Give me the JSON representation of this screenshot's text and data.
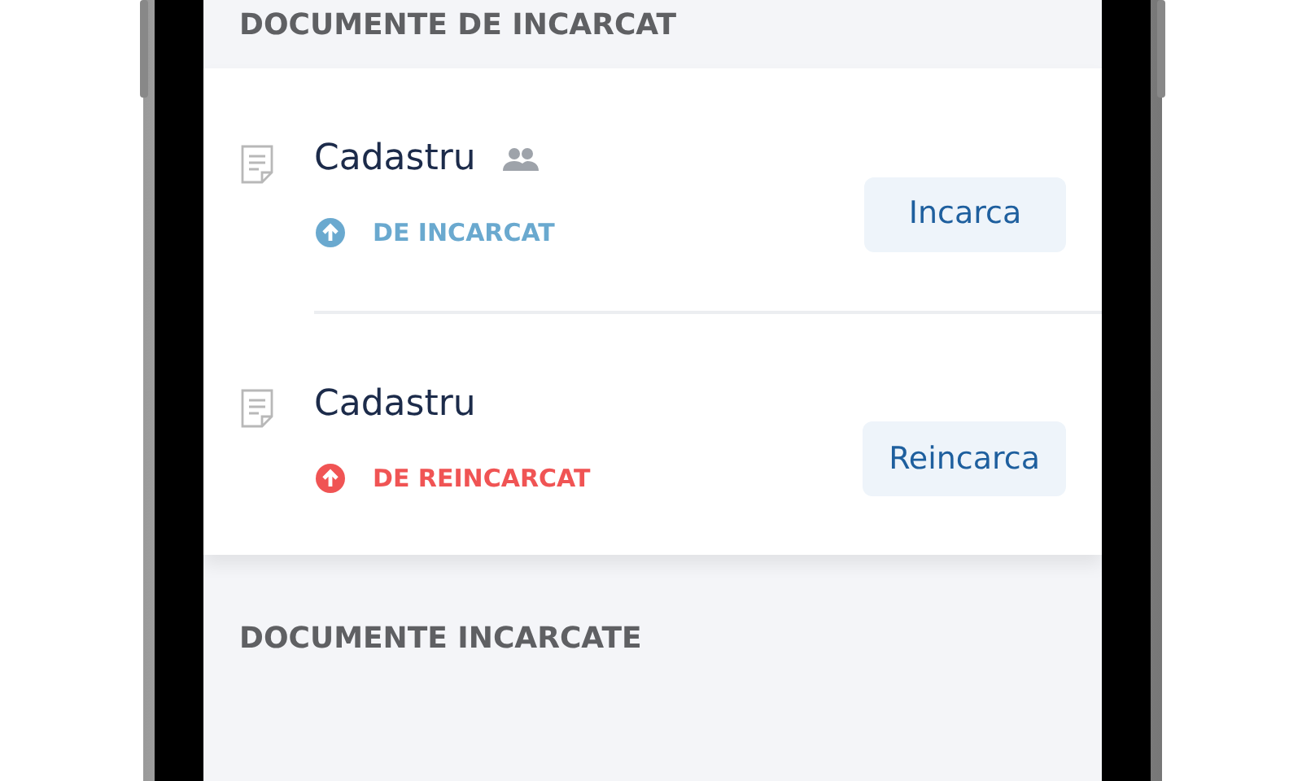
{
  "sections": [
    {
      "title": "DOCUMENTE DE INCARCAT",
      "documents": [
        {
          "title": "Cadastru",
          "shared": true,
          "status": {
            "kind": "upload",
            "label": "DE INCARCAT"
          },
          "button": "Incarca"
        },
        {
          "title": "Cadastru",
          "shared": false,
          "status": {
            "kind": "reupload",
            "label": "DE REINCARCAT"
          },
          "button": "Reincarca"
        }
      ]
    },
    {
      "title": "DOCUMENTE INCARCATE"
    }
  ]
}
